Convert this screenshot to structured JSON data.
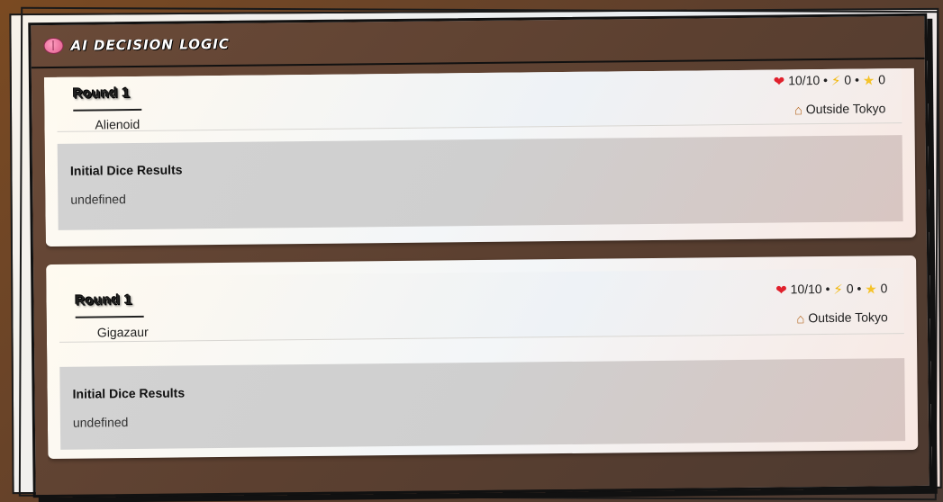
{
  "panel": {
    "title": "AI DECISION LOGIC",
    "icon": "brain-icon"
  },
  "entries": [
    {
      "round_label": "Round 1",
      "monster": "Alienoid",
      "health": "10/10",
      "energy": "0",
      "points": "0",
      "location": "Outside Tokyo",
      "section_title": "Initial Dice Results",
      "section_value": "undefined"
    },
    {
      "round_label": "Round 1",
      "monster": "Gigazaur",
      "health": "10/10",
      "energy": "0",
      "points": "0",
      "location": "Outside Tokyo",
      "section_title": "Initial Dice Results",
      "section_value": "undefined"
    }
  ],
  "colors": {
    "heart": "#e0202c",
    "bolt": "#f2b90f",
    "star": "#f5c32a"
  }
}
